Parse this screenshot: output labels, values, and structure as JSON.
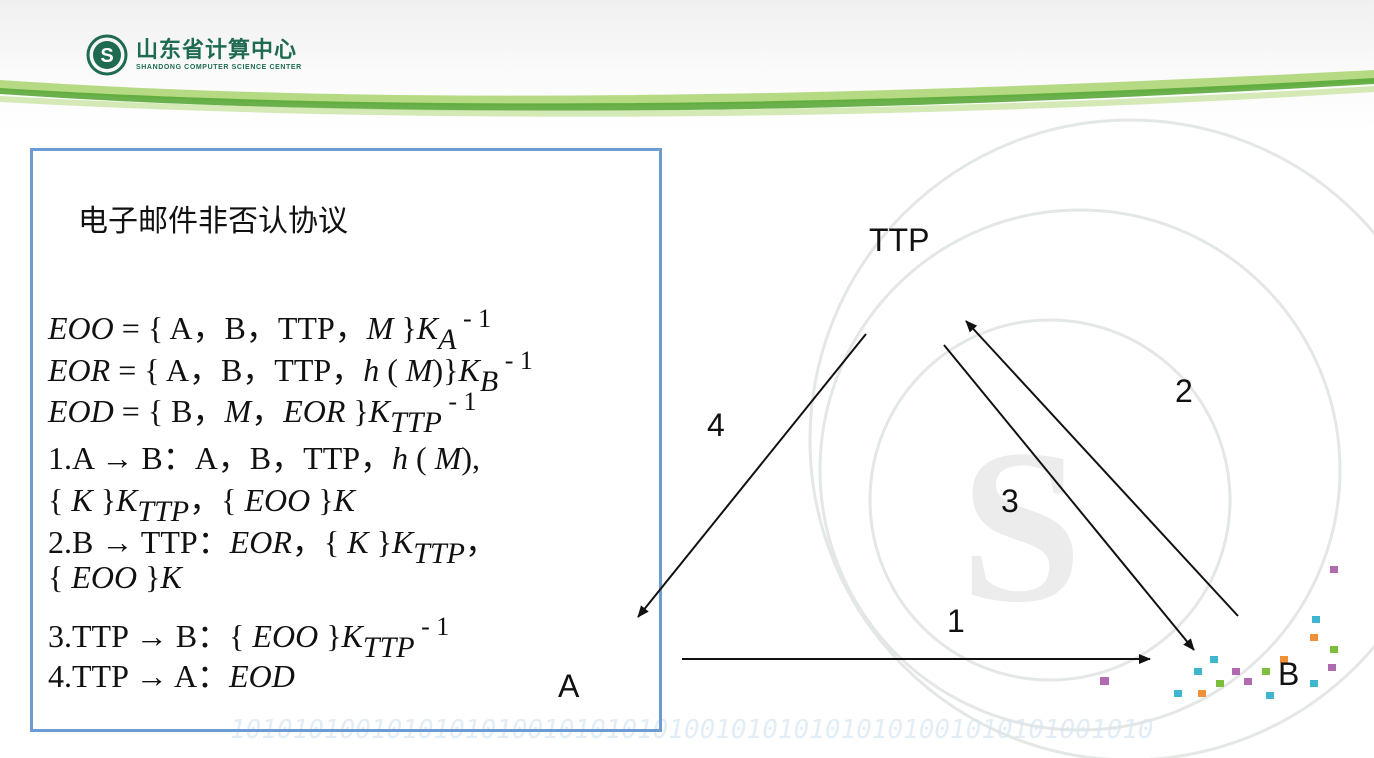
{
  "logo": {
    "name_cn": "山东省计算中心",
    "name_en": "SHANDONG COMPUTER SCIENCE CENTER"
  },
  "box": {
    "title": "电子邮件非否认协议",
    "lines": [
      {
        "parts": [
          [
            "i",
            "EOO"
          ],
          [
            "t",
            " = { A，B，TTP，"
          ],
          [
            "i",
            "M"
          ],
          [
            "t",
            " }"
          ],
          [
            "i",
            "K"
          ],
          [
            "sub",
            "A"
          ],
          [
            "sup",
            " - 1"
          ]
        ]
      },
      {
        "parts": [
          [
            "i",
            "EOR"
          ],
          [
            "t",
            " = { A，B，TTP，"
          ],
          [
            "i",
            "h"
          ],
          [
            "t",
            " ( "
          ],
          [
            "i",
            "M"
          ],
          [
            "t",
            ")}"
          ],
          [
            "i",
            "K"
          ],
          [
            "sub",
            "B"
          ],
          [
            "sup",
            " - 1"
          ]
        ]
      },
      {
        "parts": [
          [
            "i",
            "EOD"
          ],
          [
            "t",
            " = { B，"
          ],
          [
            "i",
            "M"
          ],
          [
            "t",
            "，"
          ],
          [
            "i",
            "EOR"
          ],
          [
            "t",
            " }"
          ],
          [
            "i",
            "K"
          ],
          [
            "sub",
            "TTP"
          ],
          [
            "sup",
            " - 1"
          ]
        ]
      },
      {
        "parts": [
          [
            "t",
            "1.A → B：A，B，TTP，"
          ],
          [
            "i",
            "h"
          ],
          [
            "t",
            " ( "
          ],
          [
            "i",
            "M"
          ],
          [
            "t",
            "),"
          ]
        ]
      },
      {
        "parts": [
          [
            "t",
            "{ "
          ],
          [
            "i",
            "K"
          ],
          [
            "t",
            " }"
          ],
          [
            "i",
            "K"
          ],
          [
            "sub",
            "TTP"
          ],
          [
            "t",
            "，{ "
          ],
          [
            "i",
            "EOO"
          ],
          [
            "t",
            " }"
          ],
          [
            "i",
            "K"
          ]
        ]
      },
      {
        "parts": [
          [
            "t",
            "2.B → TTP："
          ],
          [
            "i",
            "EOR"
          ],
          [
            "t",
            "，{ "
          ],
          [
            "i",
            "K"
          ],
          [
            "t",
            " }"
          ],
          [
            "i",
            "K"
          ],
          [
            "sub",
            "TTP"
          ],
          [
            "t",
            "，"
          ]
        ]
      },
      {
        "parts": [
          [
            "t",
            "{ "
          ],
          [
            "i",
            "EOO"
          ],
          [
            "t",
            " }"
          ],
          [
            "i",
            "K"
          ]
        ]
      },
      {
        "parts": [
          [
            "t",
            "3.TTP → B：{ "
          ],
          [
            "i",
            "EOO"
          ],
          [
            "t",
            " }"
          ],
          [
            "i",
            "K"
          ],
          [
            "sub",
            "TTP"
          ],
          [
            "sup",
            " - 1"
          ]
        ]
      },
      {
        "parts": [
          [
            "t",
            "4.TTP → A："
          ],
          [
            "i",
            "EOD"
          ]
        ]
      }
    ]
  },
  "diagram": {
    "nodes": {
      "ttp": "TTP",
      "a": "A",
      "b": "B"
    },
    "edge_labels": {
      "e1": "1",
      "e2": "2",
      "e3": "3",
      "e4": "4"
    }
  },
  "colors": {
    "box_border": "#6f9bd3",
    "logo_green": "#1e6b52",
    "swoosh_green": "#7cbf3a"
  }
}
